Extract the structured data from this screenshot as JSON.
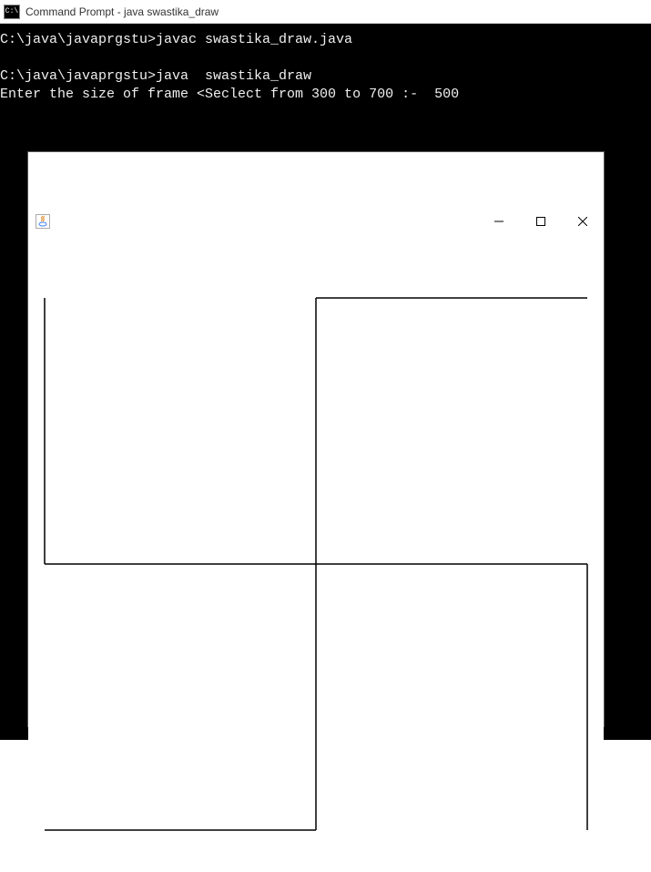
{
  "cmd": {
    "icon_label": "C:\\",
    "title": "Command Prompt - java  swastika_draw",
    "lines": {
      "l1": "C:\\java\\javaprgstu>javac swastika_draw.java",
      "l2": "",
      "l3_prompt": "C:\\java\\javaprgstu>java  swastika_draw",
      "l4_label": "Enter the size of frame <Seclect from 300 to 700 :-  ",
      "l4_value": "500"
    }
  },
  "java_window": {
    "icon_name": "java-cup-icon",
    "controls": {
      "minimize": "—",
      "maximize": "☐",
      "close": "✕"
    }
  }
}
